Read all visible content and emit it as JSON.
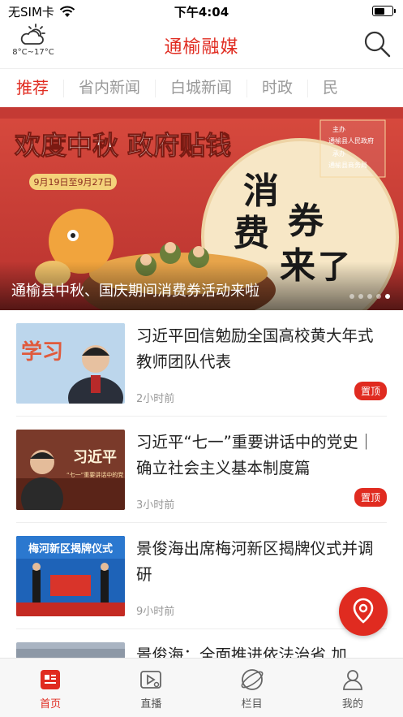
{
  "status_bar": {
    "carrier": "无SIM卡",
    "time": "下午4:04",
    "battery_level": 0.6
  },
  "header": {
    "weather_icon": "partly-cloudy-icon",
    "temperature": "8°C~17°C",
    "title": "通榆融媒",
    "search_icon": "search-icon"
  },
  "tabs": [
    {
      "label": "推荐",
      "active": true
    },
    {
      "label": "省内新闻",
      "active": false
    },
    {
      "label": "白城新闻",
      "active": false
    },
    {
      "label": "时政",
      "active": false
    },
    {
      "label": "民",
      "active": false
    }
  ],
  "banner": {
    "caption": "通榆县中秋、国庆期间消费券活动来啦",
    "image_text": {
      "line1": "欢度中秋  政府贴钱",
      "date_range": "9月19日至9月27日",
      "vertical": "消费券来了",
      "sponsor1": "主办",
      "sponsor2": "通榆县人民政府",
      "sponsor3": "承办",
      "sponsor4": "通榆县商务局"
    },
    "dot_count": 5,
    "active_dot": 4
  },
  "news": [
    {
      "title": "习近平回信勉励全国高校黄大年式教师团队代表",
      "time": "2小时前",
      "badge": "置顶",
      "thumb_text": "学习"
    },
    {
      "title": "习近平“七一”重要讲话中的党史｜确立社会主义基本制度篇",
      "time": "3小时前",
      "badge": "置顶",
      "thumb_text": "习近平",
      "thumb_sub": "“七一”重要讲话中的党"
    },
    {
      "title": "景俊海出席梅河新区揭牌仪式并调研",
      "time": "9小时前",
      "badge": "",
      "thumb_text": "梅河新区揭牌仪式"
    },
    {
      "title": "景俊海：全面推进依法治省 加",
      "time": "",
      "badge": "",
      "thumb_text": ""
    }
  ],
  "fab_icon": "location-pin-icon",
  "bottom_nav": [
    {
      "label": "首页",
      "icon": "news-icon",
      "active": true
    },
    {
      "label": "直播",
      "icon": "live-video-icon",
      "active": false
    },
    {
      "label": "栏目",
      "icon": "planet-icon",
      "active": false
    },
    {
      "label": "我的",
      "icon": "user-icon",
      "active": false
    }
  ],
  "colors": {
    "accent": "#e02b20",
    "inactive_tab": "#999999",
    "banner_bg": "#c53a3a"
  }
}
